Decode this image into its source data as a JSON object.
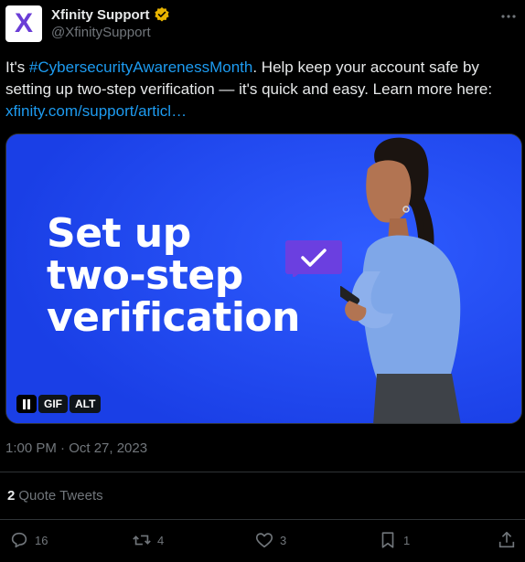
{
  "author": {
    "display_name": "Xfinity Support",
    "handle": "@XfinitySupport",
    "avatar_letter": "X",
    "verified_color": "#e8b400"
  },
  "tweet": {
    "text_prefix": "It's ",
    "hashtag": "#CybersecurityAwarenessMonth",
    "text_body": ". Help keep your account safe by setting up two-step verification — it's quick and easy. Learn more here: ",
    "link": "xfinity.com/support/articl…"
  },
  "media": {
    "headline_lines": [
      "Set up",
      "two-step",
      "verification"
    ],
    "bg_color": "#1f47f0",
    "controls": {
      "gif_label": "GIF",
      "alt_label": "ALT"
    }
  },
  "meta": {
    "timestamp": "1:00 PM · Oct 27, 2023"
  },
  "quote_tweets": {
    "count": "2",
    "label": "Quote Tweets"
  },
  "actions": {
    "replies": "16",
    "retweets": "4",
    "likes": "3",
    "bookmarks": "1"
  },
  "colors": {
    "accent": "#1d9bf0",
    "muted": "#71767b",
    "text": "#e7e9ea"
  }
}
